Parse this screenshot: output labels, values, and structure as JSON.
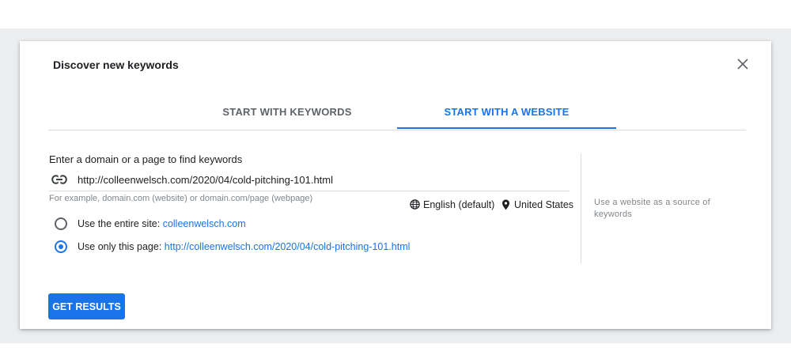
{
  "dialog": {
    "title": "Discover new keywords",
    "close_icon": "close-icon"
  },
  "tabs": [
    {
      "label": "START WITH KEYWORDS",
      "active": false
    },
    {
      "label": "START WITH A WEBSITE",
      "active": true
    }
  ],
  "website_form": {
    "field_label": "Enter a domain or a page to find keywords",
    "url_value": "http://colleenwelsch.com/2020/04/cold-pitching-101.html",
    "url_icon": "link-icon",
    "hint": "For example, domain.com (website) or domain.com/page (webpage)",
    "language": {
      "icon": "globe-icon",
      "label": "English (default)"
    },
    "location": {
      "icon": "location-pin-icon",
      "label": "United States"
    },
    "scope_options": [
      {
        "label": "Use the entire site:",
        "link": "colleenwelsch.com",
        "selected": false
      },
      {
        "label": "Use only this page:",
        "link": "http://colleenwelsch.com/2020/04/cold-pitching-101.html",
        "selected": true
      }
    ]
  },
  "side_note": "Use a website as a source of keywords",
  "actions": {
    "get_results_label": "GET RESULTS"
  },
  "colors": {
    "accent": "#1a73e8",
    "text": "#202124",
    "muted": "#80868b",
    "divider": "#dadce0"
  }
}
